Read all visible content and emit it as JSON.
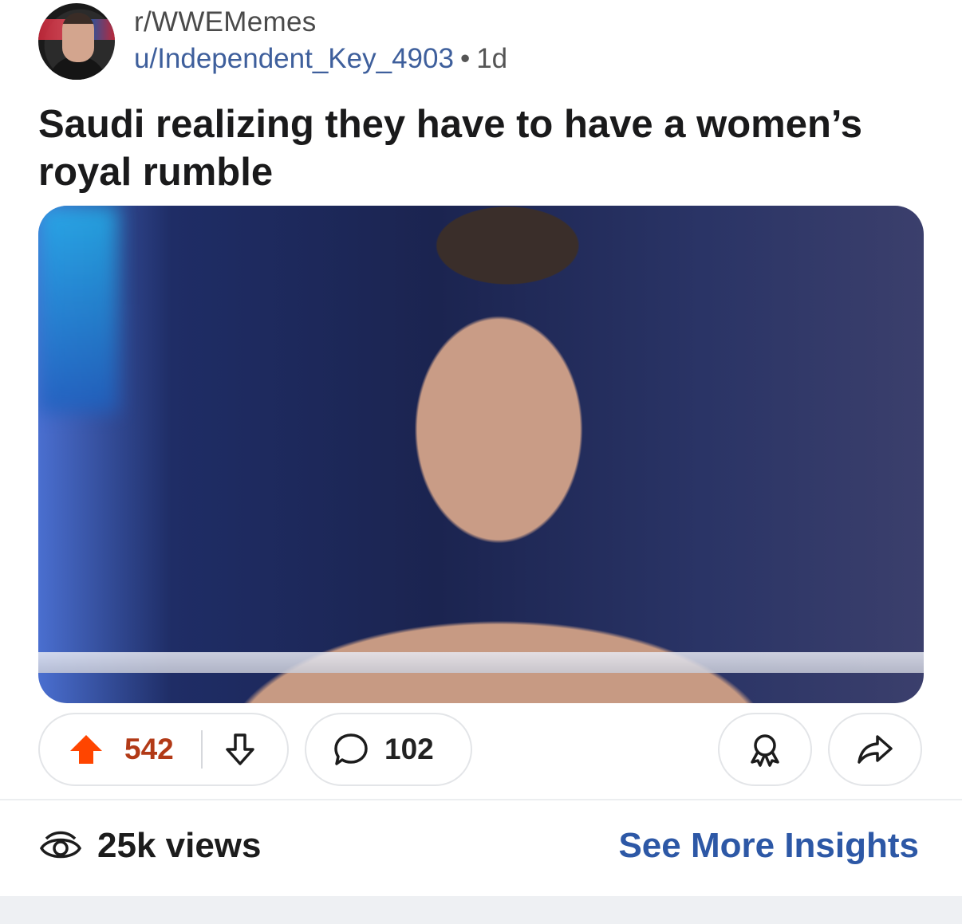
{
  "post": {
    "subreddit": "r/WWEMemes",
    "author": "u/Independent_Key_4903",
    "separator": "•",
    "age": "1d",
    "title": "Saudi realizing they have to have a women’s royal rumble"
  },
  "actions": {
    "score": "542",
    "comments": "102",
    "upvote_color": "#ff4500",
    "score_color": "#b23a17"
  },
  "footer": {
    "views": "25k views",
    "insights_label": "See More Insights",
    "insights_color": "#2d58a6"
  },
  "icons": {
    "upvote": "upvote-arrow-icon",
    "downvote": "downvote-arrow-icon",
    "comment": "comment-bubble-icon",
    "award": "award-ribbon-icon",
    "share": "share-arrow-icon",
    "views": "eye-icon"
  }
}
